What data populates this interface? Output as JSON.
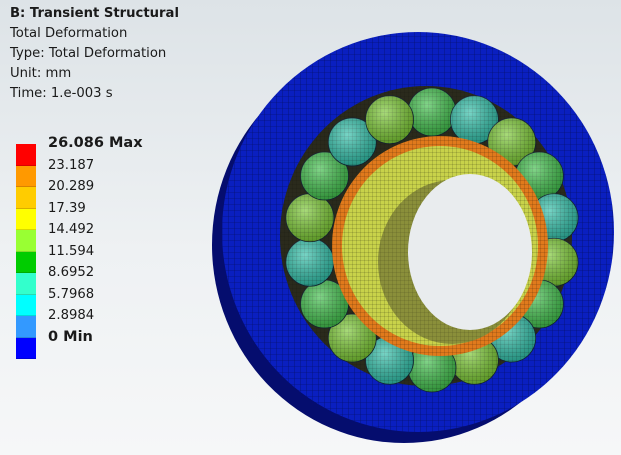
{
  "result_info": {
    "title": "B: Transient Structural",
    "lines": [
      "Total Deformation",
      "Type: Total Deformation",
      "Unit: mm",
      "Time: 1.e-003 s"
    ]
  },
  "legend": {
    "max_label": "26.086 Max",
    "min_label": "0 Min",
    "levels": [
      "23.187",
      "20.289",
      "17.39",
      "14.492",
      "11.594",
      "8.6952",
      "5.7968",
      "2.8984"
    ],
    "colors": [
      "#ff0000",
      "#ff9900",
      "#ffcc00",
      "#ffff00",
      "#99ff33",
      "#00cc00",
      "#33ffcc",
      "#00ffff",
      "#3399ff",
      "#0000ff"
    ]
  },
  "model": {
    "outer_ring_color": "#0a1fc0",
    "inner_ring_color": "#c8d24a",
    "inner_ring_edge_color": "#e07a1c",
    "roller_colors": [
      "#3fbf4a",
      "#2fbfa8",
      "#7ac832"
    ]
  }
}
